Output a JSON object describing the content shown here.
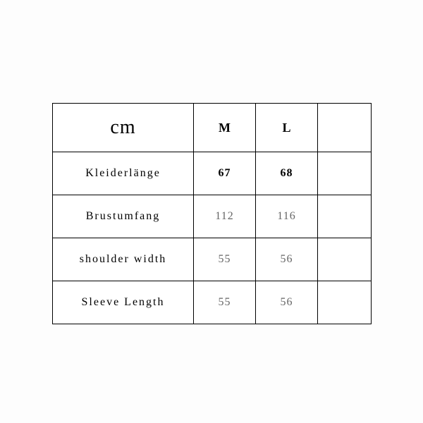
{
  "chart_data": {
    "type": "table",
    "title": "",
    "unit_label": "cm",
    "columns": [
      "M",
      "L",
      ""
    ],
    "rows": [
      {
        "label": "Kleiderlänge",
        "values": [
          "67",
          "68",
          ""
        ],
        "bold": true
      },
      {
        "label": "Brustumfang",
        "values": [
          "112",
          "116",
          ""
        ],
        "bold": false
      },
      {
        "label": "shoulder width",
        "values": [
          "55",
          "56",
          ""
        ],
        "bold": false
      },
      {
        "label": "Sleeve Length",
        "values": [
          "55",
          "56",
          ""
        ],
        "bold": false
      }
    ]
  }
}
